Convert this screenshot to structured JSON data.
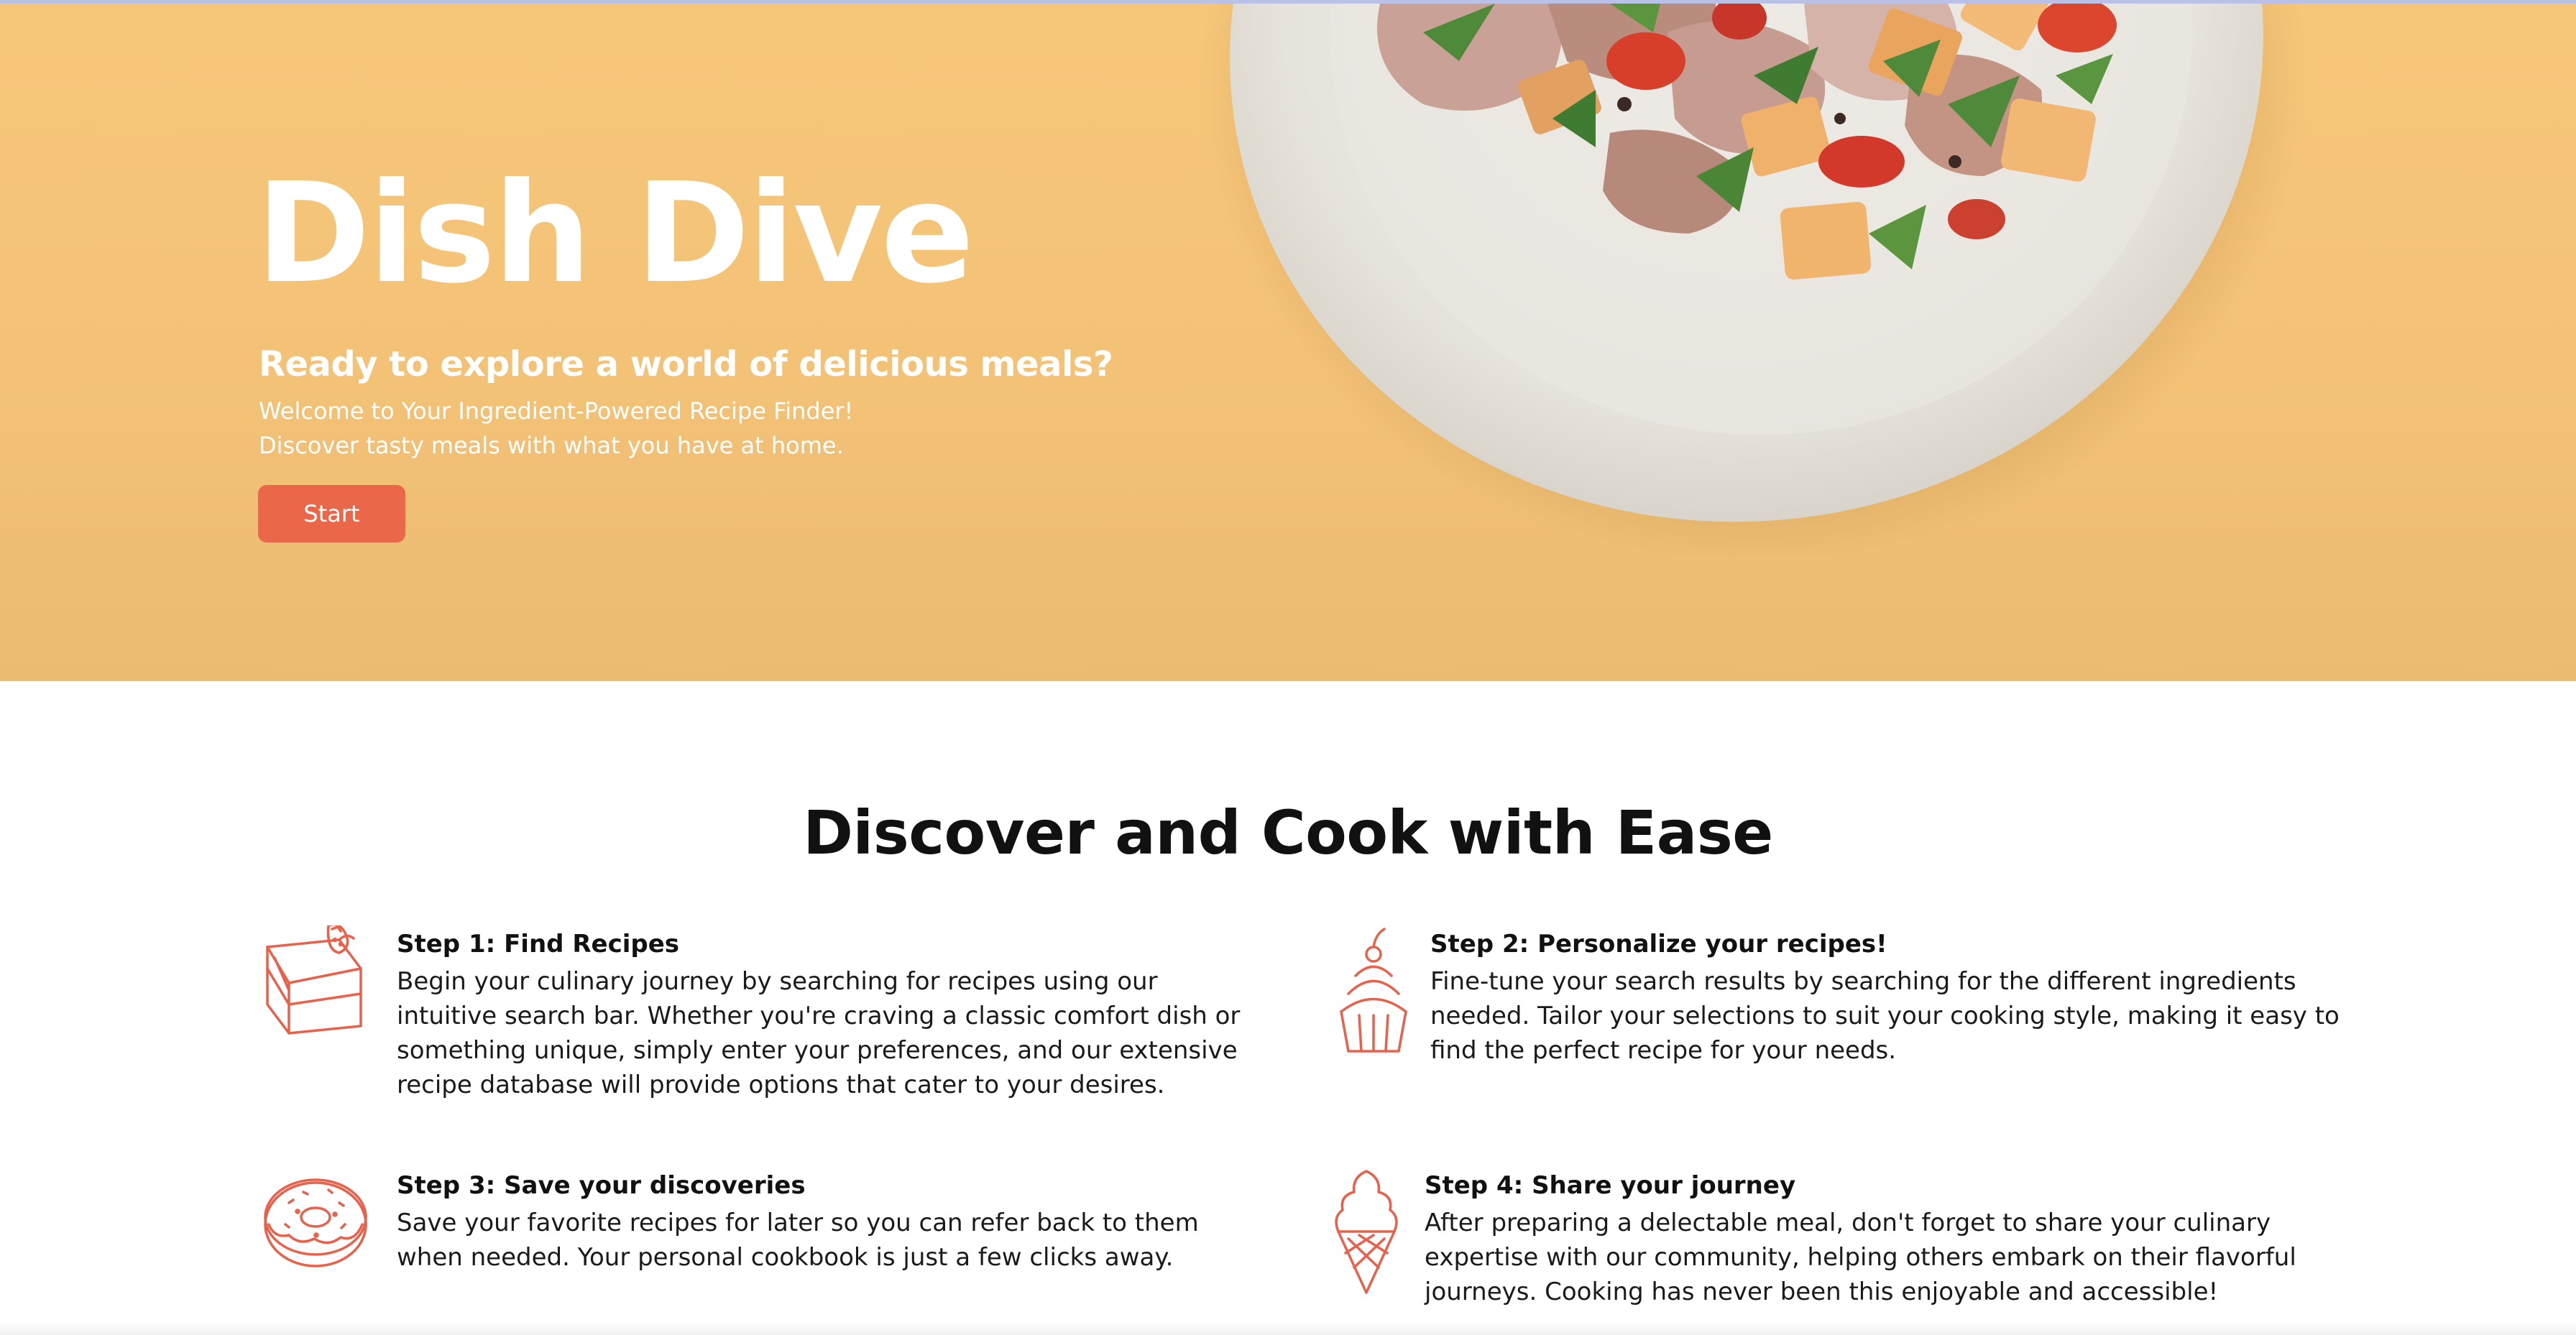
{
  "hero": {
    "title": "Dish Dive",
    "subtitle": "Ready to explore a world of delicious meals?",
    "line1": "Welcome to Your Ingredient-Powered Recipe Finder!",
    "line2": "Discover tasty meals with what you have at home.",
    "start_label": "Start",
    "image_icon": "salad-plate-photo"
  },
  "features": {
    "title": "Discover and Cook with Ease",
    "steps": [
      {
        "title": "Step 1: Find Recipes",
        "body": "Begin your culinary journey by searching for recipes using our intuitive search bar. Whether you're craving a classic comfort dish or something unique, simply enter your preferences, and our extensive recipe database will provide options that cater to your desires.",
        "icon": "cake-slice-icon"
      },
      {
        "title": "Step 2: Personalize your recipes!",
        "body": "Fine-tune your search results by searching for the different ingredients needed. Tailor your selections to suit your cooking style, making it easy to find the perfect recipe for your needs.",
        "icon": "cupcake-icon"
      },
      {
        "title": "Step 3: Save your discoveries",
        "body": "Save your favorite recipes for later so you can refer back to them when needed. Your personal cookbook is just a few clicks away.",
        "icon": "donut-icon"
      },
      {
        "title": "Step 4: Share your journey",
        "body": "After preparing a delectable meal, don't forget to share your culinary expertise with our community, helping others embark on their flavorful journeys. Cooking has never been this enjoyable and accessible!",
        "icon": "ice-cream-cone-icon"
      }
    ]
  },
  "colors": {
    "hero_bg": "#f5c478",
    "accent": "#ea6749",
    "icon_stroke": "#e8614a"
  }
}
